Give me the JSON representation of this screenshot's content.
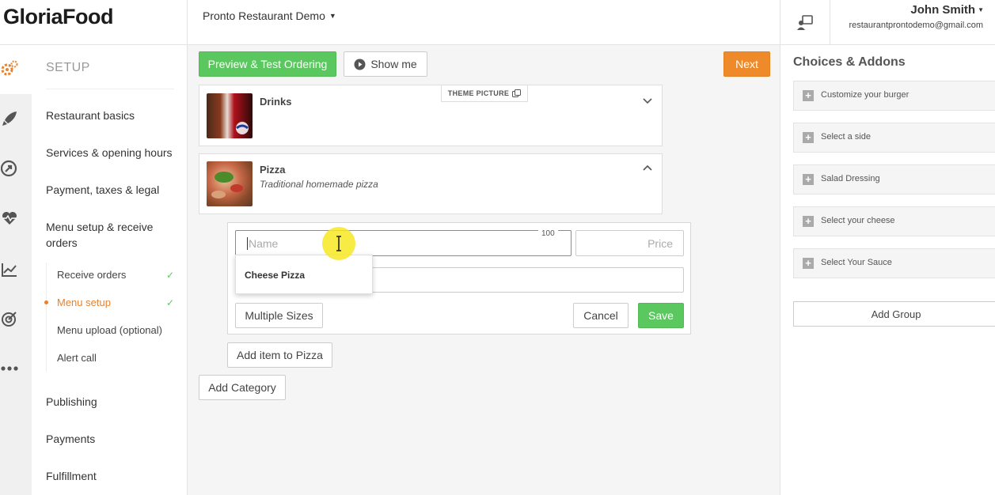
{
  "brand": {
    "logo": "GloriaFood"
  },
  "header": {
    "restaurant": "Pronto Restaurant Demo",
    "user_name": "John Smith",
    "user_email": "restaurantprontodemo@gmail.com"
  },
  "sidebar": {
    "title": "SETUP",
    "items": [
      {
        "label": "Restaurant basics"
      },
      {
        "label": "Services & opening hours"
      },
      {
        "label": "Payment, taxes & legal"
      },
      {
        "label": "Menu setup & receive orders"
      }
    ],
    "subitems": [
      {
        "label": "Receive orders",
        "done": true
      },
      {
        "label": "Menu setup",
        "done": true,
        "active": true
      },
      {
        "label": "Menu upload (optional)"
      },
      {
        "label": "Alert call"
      }
    ],
    "bottom_items": [
      {
        "label": "Publishing"
      },
      {
        "label": "Payments"
      },
      {
        "label": "Fulfillment"
      }
    ]
  },
  "toolbar": {
    "preview": "Preview & Test Ordering",
    "show_me": "Show me",
    "next": "Next"
  },
  "theme_picture": "THEME PICTURE",
  "categories": [
    {
      "name": "Drinks",
      "description": ""
    },
    {
      "name": "Pizza",
      "description": "Traditional homemade pizza"
    }
  ],
  "item_form": {
    "name_placeholder": "Name",
    "name_counter": "100",
    "price_placeholder": "Price",
    "suggestion": "Cheese Pizza",
    "multiple_sizes": "Multiple Sizes",
    "cancel": "Cancel",
    "save": "Save"
  },
  "add_item": "Add item to Pizza",
  "add_category": "Add Category",
  "choices": {
    "title": "Choices & Addons",
    "groups": [
      "Customize your burger",
      "Select a side",
      "Salad Dressing",
      "Select your cheese",
      "Select Your Sauce"
    ],
    "add_group": "Add Group"
  },
  "colors": {
    "accent": "#e9822d",
    "green": "#5bc85f",
    "orange": "#ef8a2b"
  }
}
